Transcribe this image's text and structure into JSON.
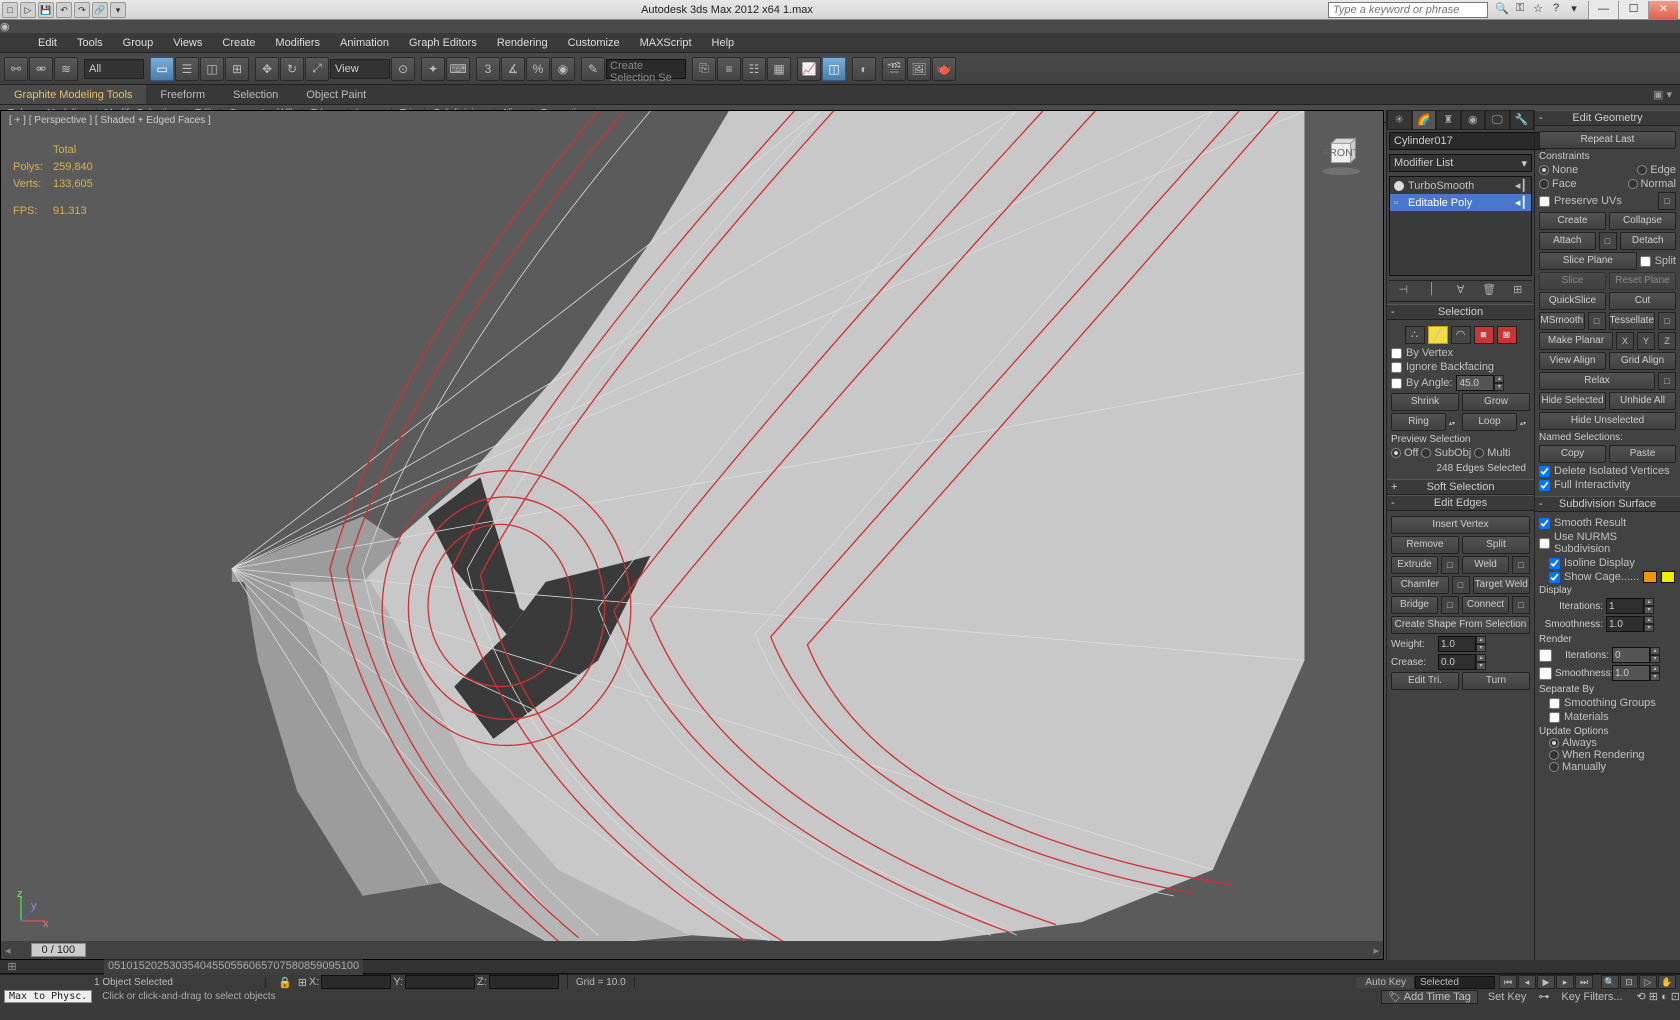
{
  "title": "Autodesk 3ds Max 2012 x64     1.max",
  "search_placeholder": "Type a keyword or phrase",
  "menubar": [
    "Edit",
    "Tools",
    "Group",
    "Views",
    "Create",
    "Modifiers",
    "Animation",
    "Graph Editors",
    "Rendering",
    "Customize",
    "MAXScript",
    "Help"
  ],
  "toolbar": {
    "filter_dd": "All",
    "view_dd": "View",
    "layer_input": "Create Selection Se"
  },
  "ribbon": {
    "tabs": [
      "Graphite Modeling Tools",
      "Freeform",
      "Selection",
      "Object Paint"
    ],
    "sub": [
      "Polygon Modeling",
      "Modify Selection",
      "Edit",
      "Geometry (All)",
      "Edges",
      "Loops",
      "Tris",
      "Subdivision",
      "Align",
      "Properties"
    ]
  },
  "viewport": {
    "label": "[ + ] [ Perspective ] [ Shaded + Edged Faces ]",
    "stats": {
      "total": "Total",
      "polys_lbl": "Polys:",
      "polys": "259,840",
      "verts_lbl": "Verts:",
      "verts": "133,605",
      "fps_lbl": "FPS:",
      "fps": "91.313"
    },
    "viewcube_face": "FRONT",
    "timeslider": "0 / 100"
  },
  "modifier": {
    "object_name": "Cylinder017",
    "modlist": "Modifier List",
    "stack": [
      "TurboSmooth",
      "Editable Poly"
    ],
    "selection": {
      "title": "Selection",
      "by_vertex": "By Vertex",
      "ignore_bf": "Ignore Backfacing",
      "by_angle": "By Angle:",
      "angle": "45.0",
      "shrink": "Shrink",
      "grow": "Grow",
      "ring": "Ring",
      "loop": "Loop",
      "preview": "Preview Selection",
      "off": "Off",
      "subobj": "SubObj",
      "multi": "Multi",
      "status": "248 Edges Selected"
    },
    "soft_sel": "Soft Selection",
    "edit_edges": {
      "title": "Edit Edges",
      "insert_vertex": "Insert Vertex",
      "remove": "Remove",
      "split": "Split",
      "extrude": "Extrude",
      "weld": "Weld",
      "chamfer": "Chamfer",
      "target_weld": "Target Weld",
      "bridge": "Bridge",
      "connect": "Connect",
      "create_shape": "Create Shape From Selection",
      "weight": "Weight:",
      "weight_v": "1.0",
      "crease": "Crease:",
      "crease_v": "0.0",
      "edit_tri": "Edit Tri.",
      "turn": "Turn"
    }
  },
  "edit_geom": {
    "title": "Edit Geometry",
    "repeat": "Repeat Last",
    "constraints": "Constraints",
    "none": "None",
    "edge": "Edge",
    "face": "Face",
    "normal": "Normal",
    "preserve_uv": "Preserve UVs",
    "create": "Create",
    "collapse": "Collapse",
    "attach": "Attach",
    "detach": "Detach",
    "slice_plane": "Slice Plane",
    "split": "Split",
    "slice": "Slice",
    "reset_plane": "Reset Plane",
    "quickslice": "QuickSlice",
    "cut": "Cut",
    "msmooth": "MSmooth",
    "tessellate": "Tessellate",
    "make_planar": "Make Planar",
    "x": "X",
    "y": "Y",
    "z": "Z",
    "view_align": "View Align",
    "grid_align": "Grid Align",
    "relax": "Relax",
    "hide_sel": "Hide Selected",
    "unhide": "Unhide All",
    "hide_unsel": "Hide Unselected",
    "named_sel": "Named Selections:",
    "copy": "Copy",
    "paste": "Paste",
    "del_iso": "Delete Isolated Vertices",
    "full_int": "Full Interactivity"
  },
  "subd": {
    "title": "Subdivision Surface",
    "smooth": "Smooth Result",
    "nurms": "Use NURMS Subdivision",
    "isoline": "Isoline Display",
    "show_cage": "Show Cage......",
    "display": "Display",
    "iterations": "Iterations:",
    "iter_v": "1",
    "smoothness": "Smoothness:",
    "smooth_v": "1.0",
    "render": "Render",
    "r_iter_v": "0",
    "r_smooth_v": "1.0",
    "sep_by": "Separate By",
    "sm_groups": "Smoothing Groups",
    "materials": "Materials",
    "update": "Update Options",
    "always": "Always",
    "when_r": "When Rendering",
    "manually": "Manually"
  },
  "status": {
    "obj_sel": "1 Object Selected",
    "x": "X:",
    "y": "Y:",
    "z": "Z:",
    "grid": "Grid = 10.0",
    "autokey": "Auto Key",
    "selected": "Selected",
    "setkey": "Set Key",
    "keyfilters": "Key Filters...",
    "add_time_tag": "Add Time Tag",
    "prompt": "Click or click-and-drag to select objects",
    "maxscript": "Max to Physc."
  },
  "timeline_ticks": [
    "0",
    "5",
    "10",
    "15",
    "20",
    "25",
    "30",
    "35",
    "40",
    "45",
    "50",
    "55",
    "60",
    "65",
    "70",
    "75",
    "80",
    "85",
    "90",
    "95",
    "100"
  ]
}
